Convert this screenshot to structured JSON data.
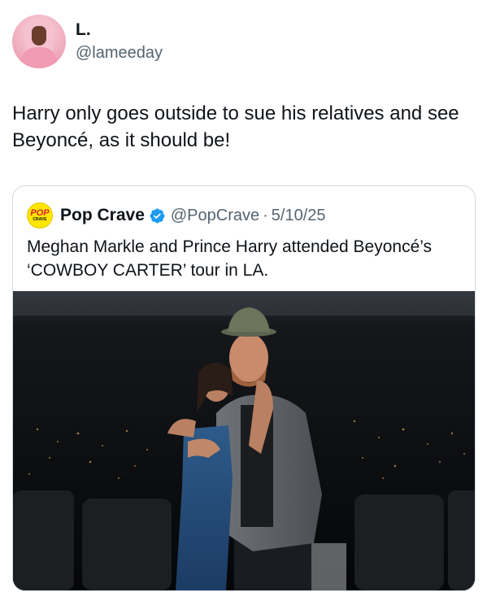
{
  "author": {
    "display_name": "L.",
    "handle": "@lameeday"
  },
  "tweet": {
    "text": "Harry only goes outside to sue his relatives and see Beyoncé, as it should be!"
  },
  "quoted": {
    "logo_line1": "POP",
    "logo_line2": "CRAVE",
    "name": "Pop Crave",
    "handle": "@PopCrave",
    "separator": "·",
    "date": "5/10/25",
    "text": "Meghan Markle and Prince Harry attended Beyoncé’s ‘COWBOY CARTER’ tour in LA.",
    "verified_icon": "verified-badge-icon",
    "verified_color": "#1d9bf0"
  },
  "colors": {
    "text": "#0f1419",
    "secondary": "#536471",
    "border": "#cfd9de"
  }
}
